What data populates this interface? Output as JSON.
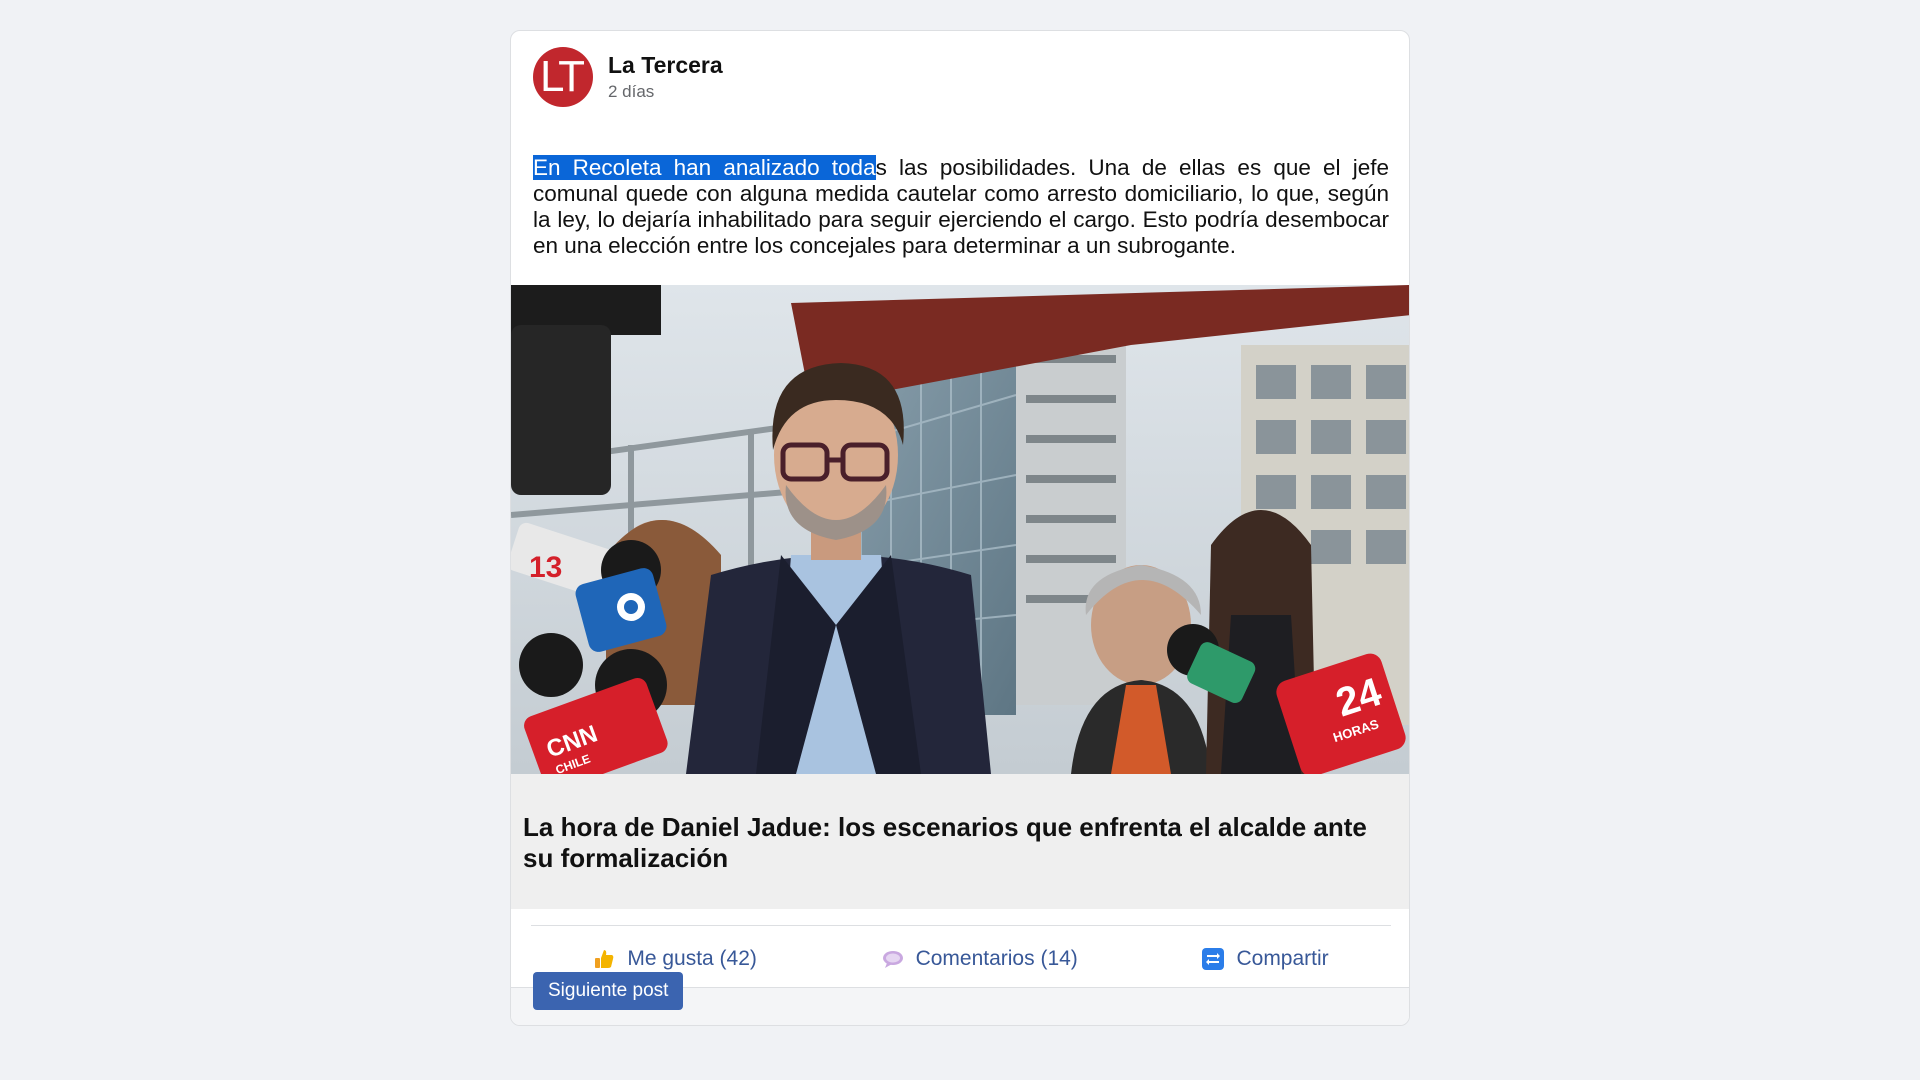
{
  "post": {
    "author": "La Tercera",
    "avatar_text": "LT",
    "time": "2 días",
    "text_selected": "En Recoleta han analizado toda",
    "text_rest": "s las posibilidades. Una de ellas es que el jefe comunal quede con alguna medida cautelar como arresto domiciliario, lo que, según la ley, lo dejaría inhabilitado para seguir ejerciendo el cargo. Esto podría desembocar en una elección entre los concejales para determinar a un subrogante.",
    "link_title": "La hora de Daniel Jadue: los escenarios que enfrenta el alcalde ante su formalización"
  },
  "image": {
    "mic_labels": [
      "13",
      "CNN",
      "CHILE",
      "24",
      "HORAS"
    ]
  },
  "actions": {
    "like_label": "Me gusta (42)",
    "comments_label": "Comentarios (14)",
    "share_label": "Compartir",
    "like_icon": "thumbs-up-icon",
    "comment_icon": "speech-bubble-icon",
    "share_icon": "repeat-icon"
  },
  "footer": {
    "next_label": "Siguiente post"
  },
  "colors": {
    "background": "#f0f2f5",
    "brand_red": "#c1272d",
    "link_blue": "#385898",
    "button_blue": "#3b64b0",
    "selection_blue": "#0a66d8"
  }
}
